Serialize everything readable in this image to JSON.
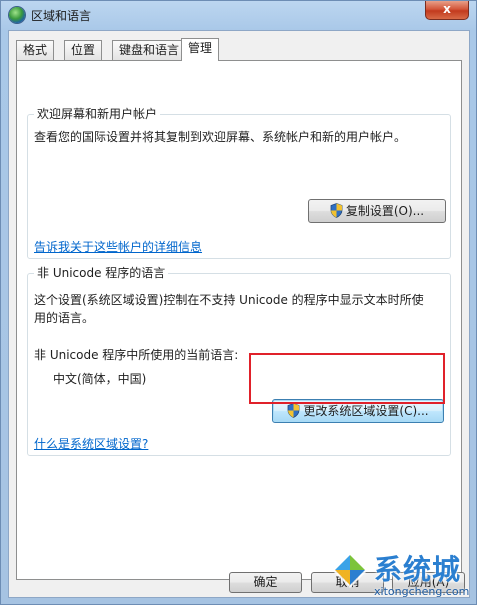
{
  "window": {
    "title": "区域和语言",
    "close_label": "x"
  },
  "tabs": [
    {
      "label": "格式",
      "active": false
    },
    {
      "label": "位置",
      "active": false
    },
    {
      "label": "键盘和语言",
      "active": false
    },
    {
      "label": "管理",
      "active": true
    }
  ],
  "welcome_group": {
    "title": "欢迎屏幕和新用户帐户",
    "description": "查看您的国际设置并将其复制到欢迎屏幕、系统帐户和新的用户帐户。",
    "copy_button": "复制设置(O)...",
    "link": "告诉我关于这些帐户的详细信息"
  },
  "unicode_group": {
    "title": "非 Unicode 程序的语言",
    "description_line1": "这个设置(系统区域设置)控制在不支持 Unicode 的程序中显示文本时所使",
    "description_line2": "用的语言。",
    "current_label": "非 Unicode 程序中所使用的当前语言:",
    "current_value": "中文(简体，中国)",
    "change_button": "更改系统区域设置(C)...",
    "link": "什么是系统区域设置?"
  },
  "footer": {
    "ok_button": "确定",
    "cancel_button": "取消",
    "apply_button": "应用(A)"
  },
  "watermark": {
    "title": "系统城",
    "subtitle": "xitongcheng.com"
  },
  "colors": {
    "link": "#0066cc",
    "highlight": "#e0212a",
    "watermark": "#2b7fd0"
  }
}
